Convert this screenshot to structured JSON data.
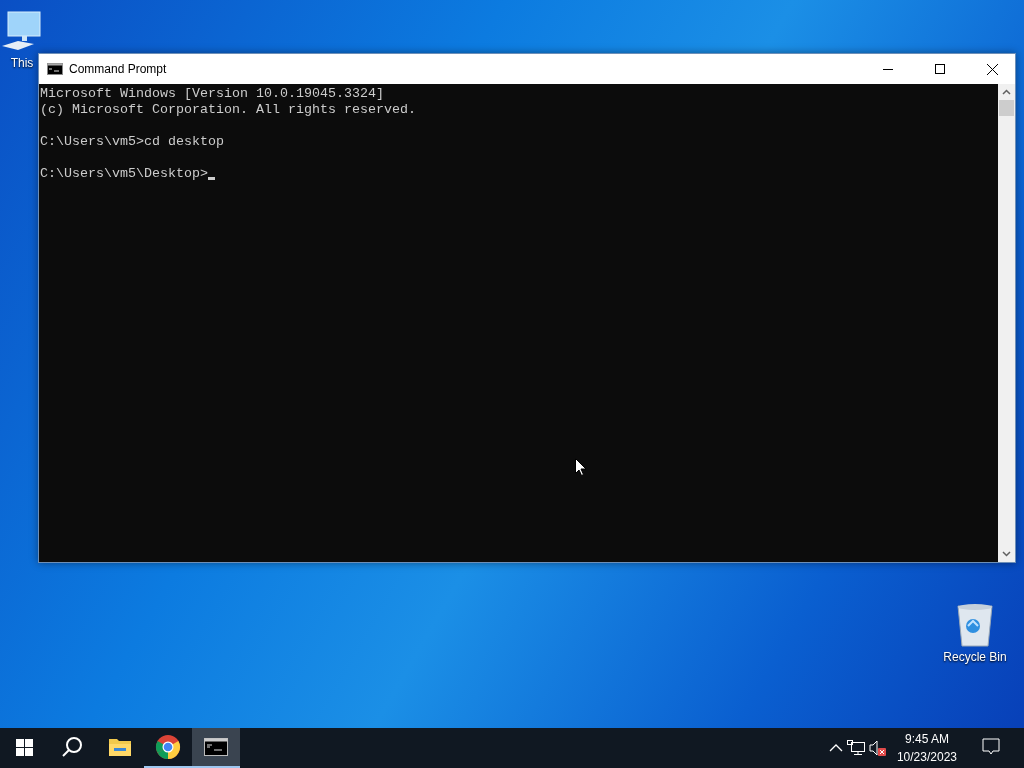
{
  "desktop_icons": [
    {
      "kind": "computer",
      "label": "This"
    },
    {
      "kind": "recycle-bin",
      "label": "Recycle Bin"
    }
  ],
  "window": {
    "title": "Command Prompt",
    "console_blocks": [
      {
        "lines": [
          "Microsoft Windows [Version 10.0.19045.3324]",
          "(c) Microsoft Corporation. All rights reserved."
        ],
        "cursor": false
      },
      {
        "lines": [
          "C:\\Users\\vm5>cd desktop"
        ],
        "cursor": false
      },
      {
        "lines": [
          "C:\\Users\\vm5\\Desktop>"
        ],
        "cursor": true
      }
    ]
  },
  "taskbar": {
    "apps": [
      {
        "kind": "explorer",
        "running": false,
        "active": false
      },
      {
        "kind": "chrome",
        "running": true,
        "active": false
      },
      {
        "kind": "cmd",
        "running": true,
        "active": true
      }
    ],
    "clock": {
      "time": "9:45 AM",
      "date": "10/23/2023"
    }
  }
}
